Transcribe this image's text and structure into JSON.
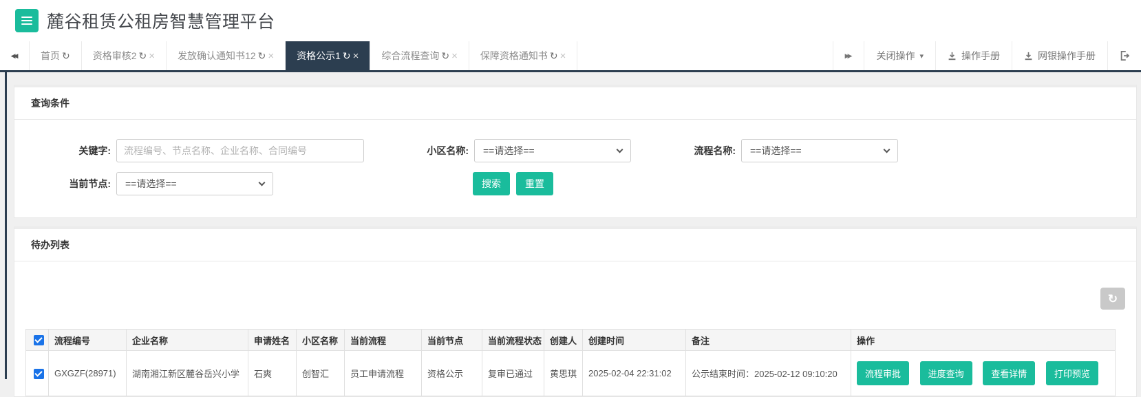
{
  "header": {
    "title": "麓谷租赁公租房智慧管理平台"
  },
  "icons": {
    "back": "◀◀",
    "forward": "▶▶",
    "refresh": "↻",
    "close": "×",
    "caret_down": "▾"
  },
  "tabbar": {
    "tabs": [
      {
        "label": "首页",
        "closable": false,
        "active": false
      },
      {
        "label": "资格审核2",
        "closable": true,
        "active": false
      },
      {
        "label": "发放确认通知书12",
        "closable": true,
        "active": false
      },
      {
        "label": "资格公示1",
        "closable": true,
        "active": true
      },
      {
        "label": "综合流程查询",
        "closable": true,
        "active": false
      },
      {
        "label": "保障资格通知书",
        "closable": true,
        "active": false
      }
    ],
    "close_operations": "关闭操作",
    "manual": "操作手册",
    "bank_manual": "网银操作手册"
  },
  "query": {
    "title": "查询条件",
    "keyword_label": "关键字:",
    "keyword_placeholder": "流程编号、节点名称、企业名称、合同编号",
    "community_label": "小区名称:",
    "process_label": "流程名称:",
    "node_label": "当前节点:",
    "select_placeholder": "==请选择==",
    "search_label": "搜索",
    "reset_label": "重置"
  },
  "todo": {
    "title": "待办列表",
    "columns": [
      "流程编号",
      "企业名称",
      "申请姓名",
      "小区名称",
      "当前流程",
      "当前节点",
      "当前流程状态",
      "创建人",
      "创建时间",
      "备注",
      "操作"
    ],
    "rows": [
      {
        "code": "GXGZF(28971)",
        "company": "湖南湘江新区麓谷岳兴小学",
        "applicant": "石爽",
        "community": "创智汇",
        "flow": "员工申请流程",
        "node": "资格公示",
        "status": "复审已通过",
        "creator": "黄思琪",
        "created": "2025-02-04 22:31:02",
        "remark": "公示结束时间：2025-02-12 09:10:20",
        "actions": [
          "流程审批",
          "进度查询",
          "查看详情",
          "打印预览"
        ]
      }
    ]
  },
  "colors": {
    "accent": "#1abc9c",
    "dark": "#2c3e50",
    "checkbox_blue": "#1a73e8"
  }
}
